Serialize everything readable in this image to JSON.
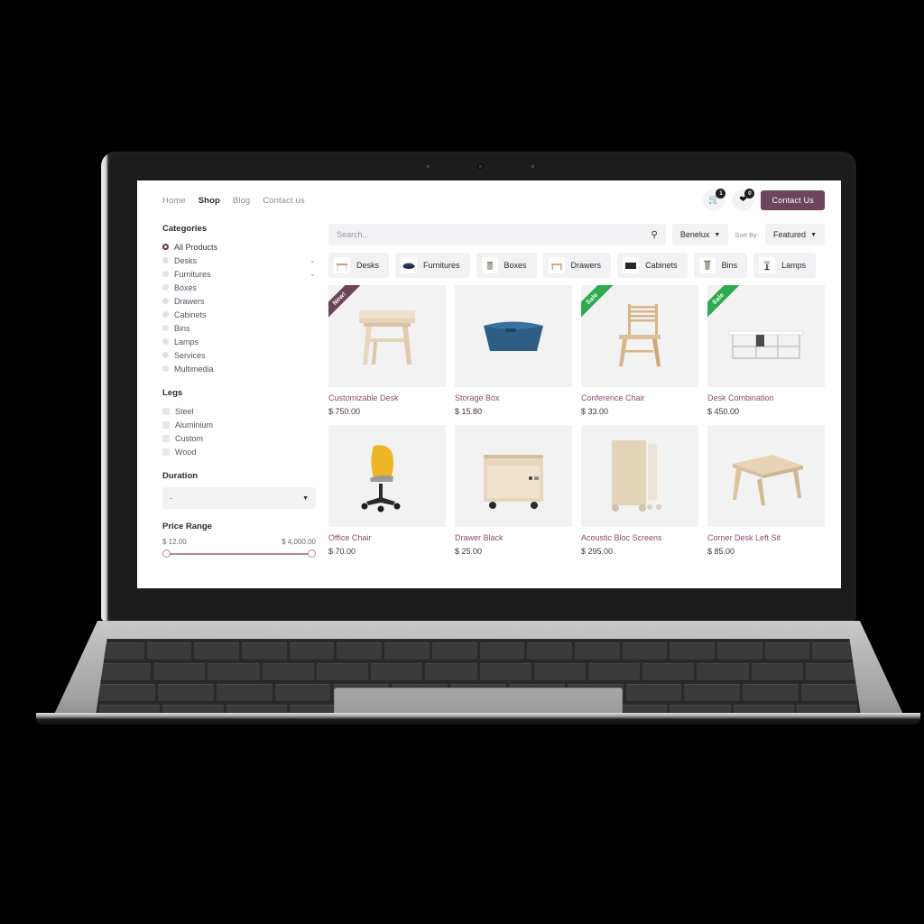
{
  "header": {
    "nav": [
      {
        "label": "Home",
        "active": false
      },
      {
        "label": "Shop",
        "active": true
      },
      {
        "label": "Blog",
        "active": false
      },
      {
        "label": "Contact us",
        "active": false
      }
    ],
    "cart": {
      "icon": "shopping-cart-icon",
      "badge": "1"
    },
    "wishlist": {
      "icon": "heart-icon",
      "badge": "0"
    },
    "contact_button": "Contact Us"
  },
  "sidebar": {
    "categories_title": "Categories",
    "categories": [
      {
        "label": "All Products",
        "selected": true,
        "expandable": false
      },
      {
        "label": "Desks",
        "selected": false,
        "expandable": true
      },
      {
        "label": "Furnitures",
        "selected": false,
        "expandable": true
      },
      {
        "label": "Boxes",
        "selected": false,
        "expandable": false
      },
      {
        "label": "Drawers",
        "selected": false,
        "expandable": false
      },
      {
        "label": "Cabinets",
        "selected": false,
        "expandable": false
      },
      {
        "label": "Bins",
        "selected": false,
        "expandable": false
      },
      {
        "label": "Lamps",
        "selected": false,
        "expandable": false
      },
      {
        "label": "Services",
        "selected": false,
        "expandable": false
      },
      {
        "label": "Multimedia",
        "selected": false,
        "expandable": false
      }
    ],
    "legs_title": "Legs",
    "legs": [
      "Steel",
      "Aluminium",
      "Custom",
      "Wood"
    ],
    "duration_title": "Duration",
    "duration_value": "-",
    "price_title": "Price Range",
    "price_min": "$ 12.00",
    "price_max": "$ 4,000.00"
  },
  "toolbar": {
    "search_placeholder": "Search...",
    "search_value": "",
    "search_icon": "search-icon",
    "region_label": "Benelux",
    "sort_by_label": "Sort By:",
    "sort_value": "Featured"
  },
  "chips": [
    {
      "label": "Desks",
      "icon": "desk-icon"
    },
    {
      "label": "Furnitures",
      "icon": "sofa-icon"
    },
    {
      "label": "Boxes",
      "icon": "box-icon"
    },
    {
      "label": "Drawers",
      "icon": "drawer-icon"
    },
    {
      "label": "Cabinets",
      "icon": "cabinet-icon"
    },
    {
      "label": "Bins",
      "icon": "bin-icon"
    },
    {
      "label": "Lamps",
      "icon": "lamp-icon"
    }
  ],
  "products": [
    {
      "name": "Customizable Desk",
      "price": "$ 750.00",
      "ribbon": "New!",
      "ribbon_type": "new",
      "image": "wood-desk-photo"
    },
    {
      "name": "Storage Box",
      "price": "$ 15.80",
      "ribbon": "",
      "ribbon_type": "",
      "image": "blue-storage-box-photo"
    },
    {
      "name": "Conference Chair",
      "price": "$ 33.00",
      "ribbon": "Sale",
      "ribbon_type": "sale",
      "image": "wood-chair-photo"
    },
    {
      "name": "Desk Combination",
      "price": "$ 450.00",
      "ribbon": "Sale",
      "ribbon_type": "sale",
      "image": "white-desk-combination-photo"
    },
    {
      "name": "Office Chair",
      "price": "$ 70.00",
      "ribbon": "",
      "ribbon_type": "",
      "image": "yellow-office-chair-photo"
    },
    {
      "name": "Drawer Black",
      "price": "$ 25.00",
      "ribbon": "",
      "ribbon_type": "",
      "image": "wood-drawer-photo"
    },
    {
      "name": "Acoustic Bloc Screens",
      "price": "$ 295.00",
      "ribbon": "",
      "ribbon_type": "",
      "image": "acoustic-screen-photo"
    },
    {
      "name": "Corner Desk Left Sit",
      "price": "$ 85.00",
      "ribbon": "",
      "ribbon_type": "",
      "image": "corner-desk-photo"
    }
  ],
  "colors": {
    "brand_purple": "#6d4459",
    "product_name": "#8b4a70",
    "sale_green": "#2eaa4f",
    "slider": "#b4879f"
  }
}
